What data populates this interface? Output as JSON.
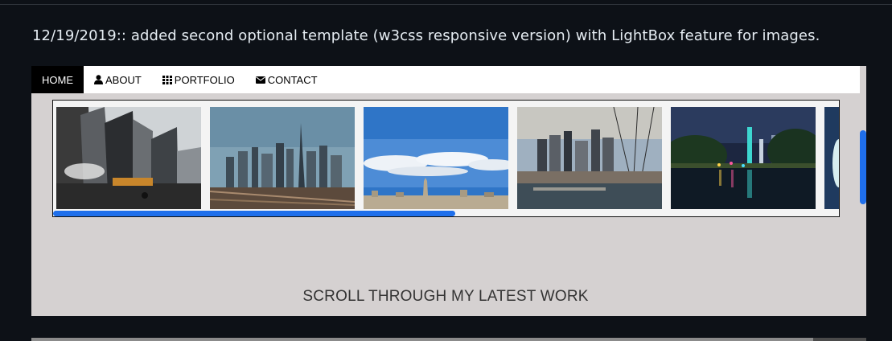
{
  "note": {
    "text": "12/19/2019:: added second optional template (w3css responsive version) with LightBox feature for images."
  },
  "nav": {
    "items": [
      {
        "label": "HOME",
        "icon": ""
      },
      {
        "label": "ABOUT",
        "icon": "user-icon"
      },
      {
        "label": "PORTFOLIO",
        "icon": "grid-icon"
      },
      {
        "label": "CONTACT",
        "icon": "envelope-icon"
      }
    ]
  },
  "gallery": {
    "images": [
      "city-street-skyscrapers",
      "brooklyn-bridge-skyline",
      "empire-state-sky",
      "manhattan-pier-skyline",
      "central-park-night-lights",
      "partial-image"
    ],
    "scroll_fraction": 0.51
  },
  "caption": {
    "text": "SCROLL THROUGH MY LATEST WORK"
  },
  "colors": {
    "accent": "#1f6feb",
    "frame_bg": "#d5d1d1",
    "page_bg": "#0d1117"
  }
}
